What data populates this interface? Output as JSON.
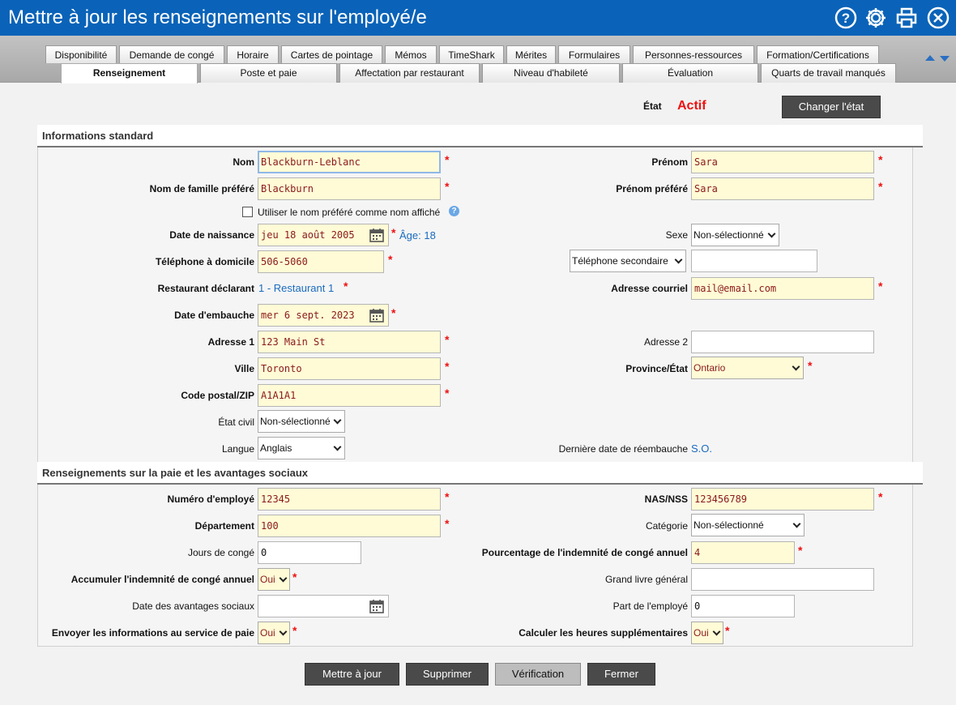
{
  "window": {
    "title": "Mettre à jour les renseignements sur l'employé/e"
  },
  "toolbar_icons": [
    "help-icon",
    "gear-icon",
    "print-icon",
    "close-icon"
  ],
  "tabs_row1": [
    "Disponibilité",
    "Demande de congé",
    "Horaire",
    "Cartes de pointage",
    "Mémos",
    "TimeShark",
    "Mérites",
    "Formulaires",
    "Personnes-ressources",
    "Formation/Certifications"
  ],
  "tabs_row2": [
    "Renseignement",
    "Poste et paie",
    "Affectation par restaurant",
    "Niveau d'habileté",
    "Évaluation",
    "Quarts de travail manqués"
  ],
  "status": {
    "label": "État",
    "value": "Actif",
    "button": "Changer l'état"
  },
  "sections": {
    "standard": "Informations standard",
    "payroll": "Renseignements sur la paie et les avantages sociaux"
  },
  "form": {
    "nom": {
      "label": "Nom",
      "value": "Blackburn-Leblanc"
    },
    "prenom": {
      "label": "Prénom",
      "value": "Sara"
    },
    "nom_pref": {
      "label": "Nom de famille préféré",
      "value": "Blackburn"
    },
    "prenom_pref": {
      "label": "Prénom préféré",
      "value": "Sara"
    },
    "use_pref": {
      "label": "Utiliser le nom préféré comme nom affiché",
      "checked": false
    },
    "naissance": {
      "label": "Date de naissance",
      "value": "jeu 18 août 2005",
      "age": "Âge: 18"
    },
    "sexe": {
      "label": "Sexe",
      "value": "Non-sélectionné"
    },
    "tel_domicile": {
      "label": "Téléphone à domicile",
      "value": "506-5060"
    },
    "tel_secondaire": {
      "type": "Téléphone secondaire",
      "value": ""
    },
    "restaurant": {
      "label": "Restaurant déclarant",
      "value": "1 - Restaurant 1"
    },
    "courriel": {
      "label": "Adresse courriel",
      "value": "mail@email.com"
    },
    "embauche": {
      "label": "Date d'embauche",
      "value": "mer 6 sept. 2023"
    },
    "adresse1": {
      "label": "Adresse 1",
      "value": "123 Main St"
    },
    "adresse2": {
      "label": "Adresse 2",
      "value": ""
    },
    "ville": {
      "label": "Ville",
      "value": "Toronto"
    },
    "province": {
      "label": "Province/État",
      "value": "Ontario"
    },
    "code_postal": {
      "label": "Code postal/ZIP",
      "value": "A1A1A1"
    },
    "etat_civil": {
      "label": "État civil",
      "value": "Non-sélectionné"
    },
    "langue": {
      "label": "Langue",
      "value": "Anglais"
    },
    "reembauche": {
      "label": "Dernière date de réembauche",
      "value": "S.O."
    },
    "num_employe": {
      "label": "Numéro d'employé",
      "value": "12345"
    },
    "nas": {
      "label": "NAS/NSS",
      "value": "123456789"
    },
    "departement": {
      "label": "Département",
      "value": "100"
    },
    "categorie": {
      "label": "Catégorie",
      "value": "Non-sélectionné"
    },
    "jours_conge": {
      "label": "Jours de congé",
      "value": "0"
    },
    "pourcentage": {
      "label": "Pourcentage de l'indemnité de congé annuel",
      "value": "4"
    },
    "accumuler": {
      "label": "Accumuler l'indemnité de congé annuel",
      "value": "Oui"
    },
    "grand_livre": {
      "label": "Grand livre général",
      "value": ""
    },
    "date_avantages": {
      "label": "Date des avantages sociaux",
      "value": ""
    },
    "part_employe": {
      "label": "Part de l'employé",
      "value": "0"
    },
    "envoyer": {
      "label": "Envoyer les informations au service de paie",
      "value": "Oui"
    },
    "heures_sup": {
      "label": "Calculer les heures supplémentaires",
      "value": "Oui"
    }
  },
  "required_mark": "*",
  "buttons": {
    "update": "Mettre à jour",
    "delete": "Supprimer",
    "verify": "Vérification",
    "close": "Fermer"
  }
}
